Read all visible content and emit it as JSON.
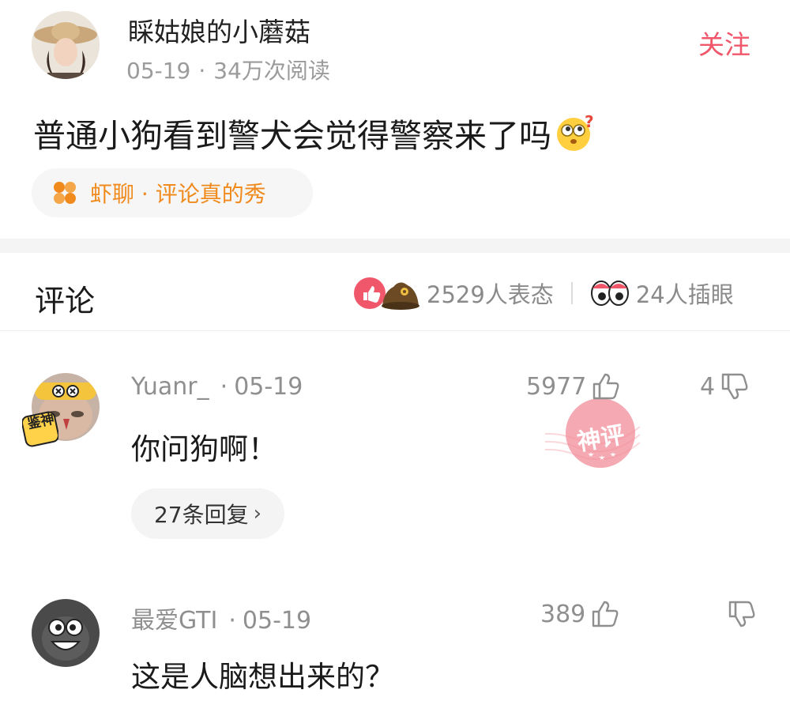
{
  "post": {
    "author": "睬姑娘的小蘑菇",
    "date": "05-19",
    "reads": "34万次阅读",
    "follow_label": "关注",
    "text": "普通小狗看到警犬会觉得警察来了吗",
    "topic": "虾聊 · 评论真的秀"
  },
  "comments_header": {
    "title": "评论",
    "reaction_count": "2529人表态",
    "peek_count": "24人插眼"
  },
  "comments": [
    {
      "user": "Yuanr_",
      "date": "05-19",
      "text": "你问狗啊！",
      "likes": "5977",
      "dislikes": "4",
      "replies_label": "27条回复",
      "badge": "鉴神",
      "stamp": "神评"
    },
    {
      "user": "最爱GTI",
      "date": "05-19",
      "text": "这是人脑想出来的？",
      "likes": "389"
    }
  ],
  "colors": {
    "accent": "#f0576b",
    "topic": "#f08a1c",
    "muted": "#8f8f8f"
  },
  "icons": [
    "thumbs-up-icon",
    "thumbs-down-icon",
    "topic-grid-icon",
    "chevron-right-icon",
    "eyes-icon",
    "heart-like-icon",
    "hat-icon",
    "rolling-eyes-emoji-icon"
  ]
}
